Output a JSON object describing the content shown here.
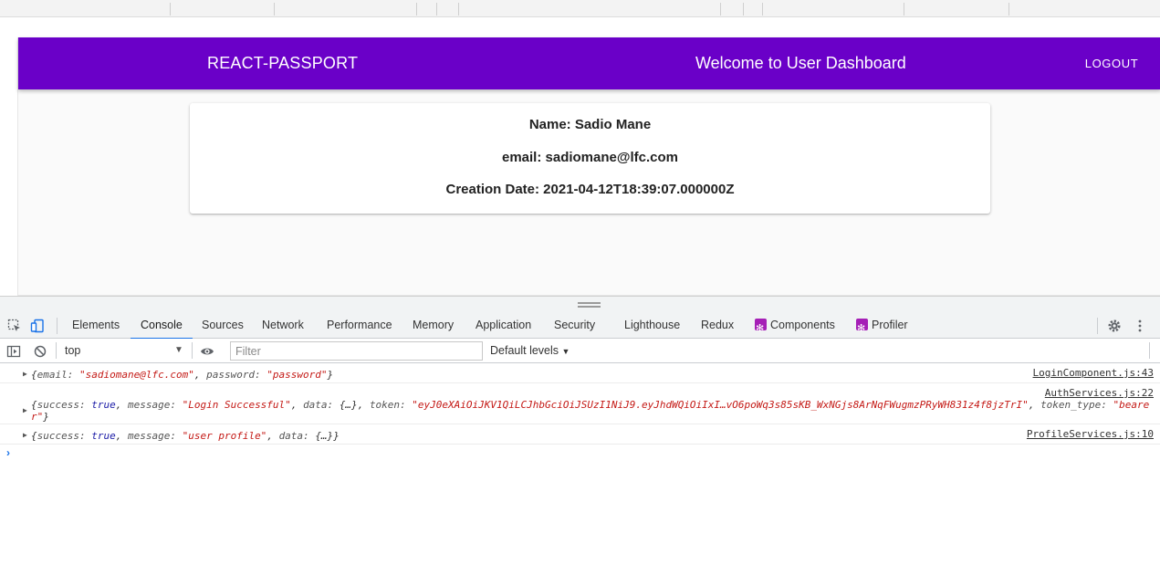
{
  "app": {
    "brand": "REACT-PASSPORT",
    "header_title": "Welcome to User Dashboard",
    "logout_label": "LOGOUT",
    "colors": {
      "appbar": "#6a00c8"
    }
  },
  "profile": {
    "name": "Name: Sadio Mane",
    "email": "email: sadiomane@lfc.com",
    "created": "Creation Date: 2021-04-12T18:39:07.000000Z"
  },
  "devtools": {
    "tabs": [
      "Elements",
      "Console",
      "Sources",
      "Network",
      "Performance",
      "Memory",
      "Application",
      "Security",
      "Lighthouse",
      "Redux",
      "Components",
      "Profiler"
    ],
    "active_tab": "Console",
    "context": "top",
    "filter_placeholder": "Filter",
    "levels_label": "Default levels",
    "icons": [
      "inspect-icon",
      "device-toggle-icon",
      "sidebar-toggle-icon",
      "clear-console-icon",
      "eye-icon",
      "settings-gear-icon",
      "kebab-menu-icon"
    ]
  },
  "console": {
    "entries": [
      {
        "source": "LoginComponent.js:43",
        "parts": [
          {
            "t": "{",
            "c": ""
          },
          {
            "t": "email: ",
            "c": "k"
          },
          {
            "t": "\"sadiomane@lfc.com\"",
            "c": "s"
          },
          {
            "t": ", ",
            "c": ""
          },
          {
            "t": "password: ",
            "c": "k"
          },
          {
            "t": "\"password\"",
            "c": "s"
          },
          {
            "t": "}",
            "c": ""
          }
        ]
      },
      {
        "source": "AuthServices.js:22",
        "parts": [
          {
            "t": "{",
            "c": ""
          },
          {
            "t": "success: ",
            "c": "k"
          },
          {
            "t": "true",
            "c": "b"
          },
          {
            "t": ", ",
            "c": ""
          },
          {
            "t": "message: ",
            "c": "k"
          },
          {
            "t": "\"Login Successful\"",
            "c": "s"
          },
          {
            "t": ", ",
            "c": ""
          },
          {
            "t": "data: ",
            "c": "k"
          },
          {
            "t": "{…}",
            "c": ""
          },
          {
            "t": ", ",
            "c": ""
          },
          {
            "t": "token: ",
            "c": "k"
          },
          {
            "t": "\"eyJ0eXAiOiJKV1QiLCJhbGciOiJSUzI1NiJ9.eyJhdWQiOiIxI…vO6poWq3s85sKB_WxNGjs8ArNqFWugmzPRyWH831z4f8jzTrI\"",
            "c": "s"
          },
          {
            "t": ", ",
            "c": ""
          },
          {
            "t": "token_type: ",
            "c": "k"
          },
          {
            "t": "\"bearer\"",
            "c": "s"
          },
          {
            "t": "}",
            "c": ""
          }
        ]
      },
      {
        "source": "ProfileServices.js:10",
        "parts": [
          {
            "t": "{",
            "c": ""
          },
          {
            "t": "success: ",
            "c": "k"
          },
          {
            "t": "true",
            "c": "b"
          },
          {
            "t": ", ",
            "c": ""
          },
          {
            "t": "message: ",
            "c": "k"
          },
          {
            "t": "\"user profile\"",
            "c": "s"
          },
          {
            "t": ", ",
            "c": ""
          },
          {
            "t": "data: ",
            "c": "k"
          },
          {
            "t": "{…}",
            "c": ""
          },
          {
            "t": "}",
            "c": ""
          }
        ]
      }
    ],
    "prompt": "›"
  }
}
